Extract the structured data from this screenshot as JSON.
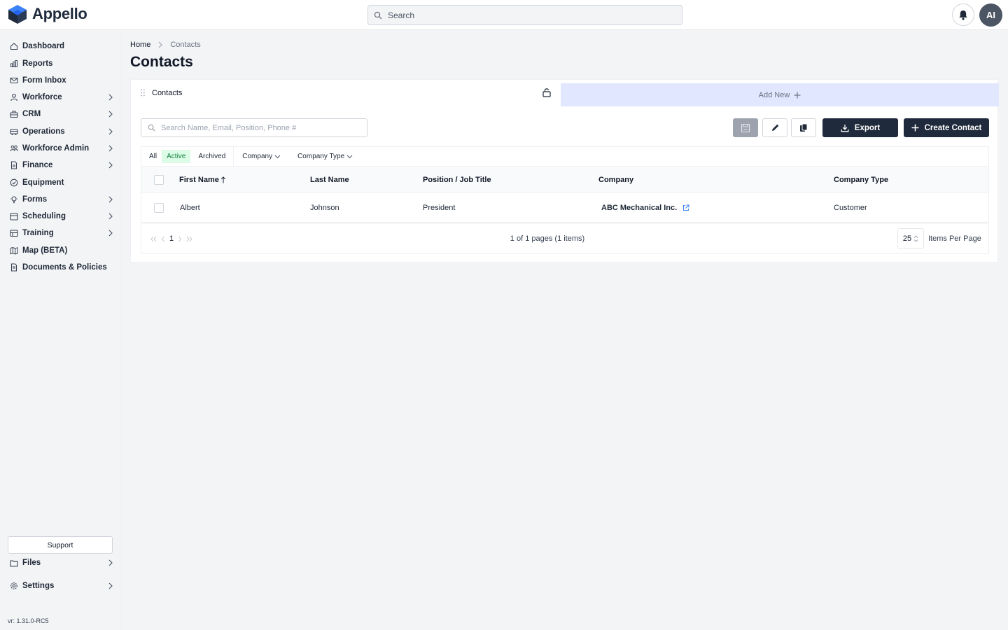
{
  "app": {
    "name": "Appello"
  },
  "header": {
    "search_placeholder": "Search",
    "avatar_initials": "AI"
  },
  "sidebar": {
    "items": [
      {
        "label": "Dashboard",
        "icon": "home-icon",
        "has_children": false
      },
      {
        "label": "Reports",
        "icon": "chart-icon",
        "has_children": false
      },
      {
        "label": "Form Inbox",
        "icon": "mail-icon",
        "has_children": false
      },
      {
        "label": "Workforce",
        "icon": "user-icon",
        "has_children": true
      },
      {
        "label": "CRM",
        "icon": "briefcase-icon",
        "has_children": true
      },
      {
        "label": "Operations",
        "icon": "truck-icon",
        "has_children": true
      },
      {
        "label": "Workforce Admin",
        "icon": "users-icon",
        "has_children": true
      },
      {
        "label": "Finance",
        "icon": "document-icon",
        "has_children": true
      },
      {
        "label": "Equipment",
        "icon": "check-circle-icon",
        "has_children": false
      },
      {
        "label": "Forms",
        "icon": "lightbulb-icon",
        "has_children": true
      },
      {
        "label": "Scheduling",
        "icon": "calendar-icon",
        "has_children": true
      },
      {
        "label": "Training",
        "icon": "book-icon",
        "has_children": true
      },
      {
        "label": "Map (BETA)",
        "icon": "map-icon",
        "has_children": false
      },
      {
        "label": "Documents & Policies",
        "icon": "file-icon",
        "has_children": false
      }
    ],
    "support_label": "Support",
    "files_label": "Files",
    "settings_label": "Settings",
    "version": "vr: 1.31.0-RC5"
  },
  "breadcrumb": {
    "home": "Home",
    "current": "Contacts"
  },
  "page": {
    "title": "Contacts"
  },
  "tabs": {
    "active_label": "Contacts",
    "add_new_label": "Add New"
  },
  "toolbar": {
    "search_placeholder": "Search Name, Email, Position, Phone #",
    "export_label": "Export",
    "create_label": "Create Contact"
  },
  "filters": {
    "status": [
      "All",
      "Active",
      "Archived"
    ],
    "selected_status": "Active",
    "company_label": "Company",
    "company_type_label": "Company Type"
  },
  "table": {
    "columns": [
      "First Name",
      "Last Name",
      "Position / Job Title",
      "Company",
      "Company Type"
    ],
    "sort_column": "First Name",
    "sort_direction": "asc",
    "rows": [
      {
        "first_name": "Albert",
        "last_name": "Johnson",
        "position": "President",
        "company": "ABC Mechanical Inc.",
        "company_type": "Customer"
      }
    ]
  },
  "pagination": {
    "page": "1",
    "info": "1 of 1 pages (1 items)",
    "per_page": "25",
    "per_page_label": "Items Per Page"
  },
  "colors": {
    "primary_dark": "#1f2a3c",
    "logo_blue": "#2563eb",
    "active_filter_bg": "#dcfce7",
    "active_filter_text": "#15803d",
    "add_tab_bg": "#e0e7ff"
  }
}
